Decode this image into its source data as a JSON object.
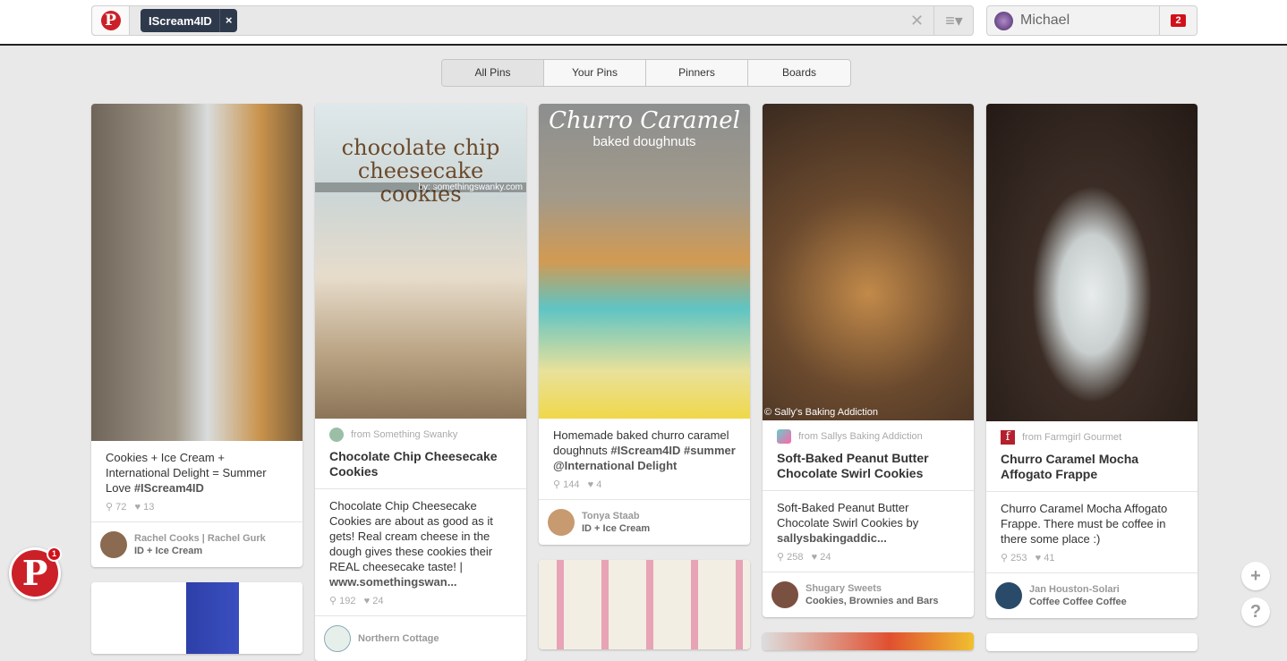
{
  "header": {
    "search_token": "IScream4ID",
    "token_remove": "×",
    "clear": "✕",
    "menu": "≡▾",
    "user_name": "Michael",
    "notifications": "2"
  },
  "tabs": [
    {
      "label": "All Pins",
      "active": true
    },
    {
      "label": "Your Pins"
    },
    {
      "label": "Pinners"
    },
    {
      "label": "Boards"
    }
  ],
  "pins": [
    {
      "description": "Cookies + Ice Cream + International Delight = Summer Love ",
      "hashtag": "#IScream4ID",
      "repins": "72",
      "likes": "13",
      "pinner": "Rachel Cooks | Rachel Gurk",
      "board": "ID + Ice Cream"
    },
    {
      "overlay_title": "chocolate chip cheesecake cookies",
      "overlay_byline": "by: somethingswanky.com",
      "source": "from Something Swanky",
      "title": "Chocolate Chip Cheesecake Cookies",
      "description": "Chocolate Chip Cheesecake Cookies are about as good as it gets! Real cream cheese in the dough gives these cookies their REAL cheesecake taste! | ",
      "link": "www.somethingswan...",
      "repins": "192",
      "likes": "24",
      "pinner": "Northern Cottage"
    },
    {
      "overlay_title": "Churro Caramel",
      "overlay_sub": "baked doughnuts",
      "description": "Homemade baked churro caramel doughnuts ",
      "hashtag": "#IScream4ID #summer @International Delight",
      "repins": "144",
      "likes": "4",
      "pinner": "Tonya Staab",
      "board": "ID + Ice Cream"
    },
    {
      "overlay_credit": "© Sally's Baking Addiction",
      "source": "from Sallys Baking Addiction",
      "title": "Soft-Baked Peanut Butter Chocolate Swirl Cookies",
      "description": "Soft-Baked Peanut Butter Chocolate Swirl Cookies by ",
      "link": "sallysbakingaddic...",
      "repins": "258",
      "likes": "24",
      "pinner": "Shugary Sweets",
      "board": "Cookies, Brownies and Bars"
    },
    {
      "source": "from Farmgirl Gourmet",
      "title": "Churro Caramel Mocha Affogato Frappe",
      "description": "Churro Caramel Mocha Affogato Frappe. There must be coffee in there some place :)",
      "repins": "253",
      "likes": "41",
      "pinner": "Jan Houston-Solari",
      "board": "Coffee Coffee Coffee"
    }
  ],
  "icons": {
    "repin": "⚲",
    "like": "♥"
  },
  "floating": {
    "add": "+",
    "help": "?",
    "pinterest_badge": "1"
  },
  "colors": {
    "brand": "#cb2027",
    "token": "#2e3a4c"
  }
}
